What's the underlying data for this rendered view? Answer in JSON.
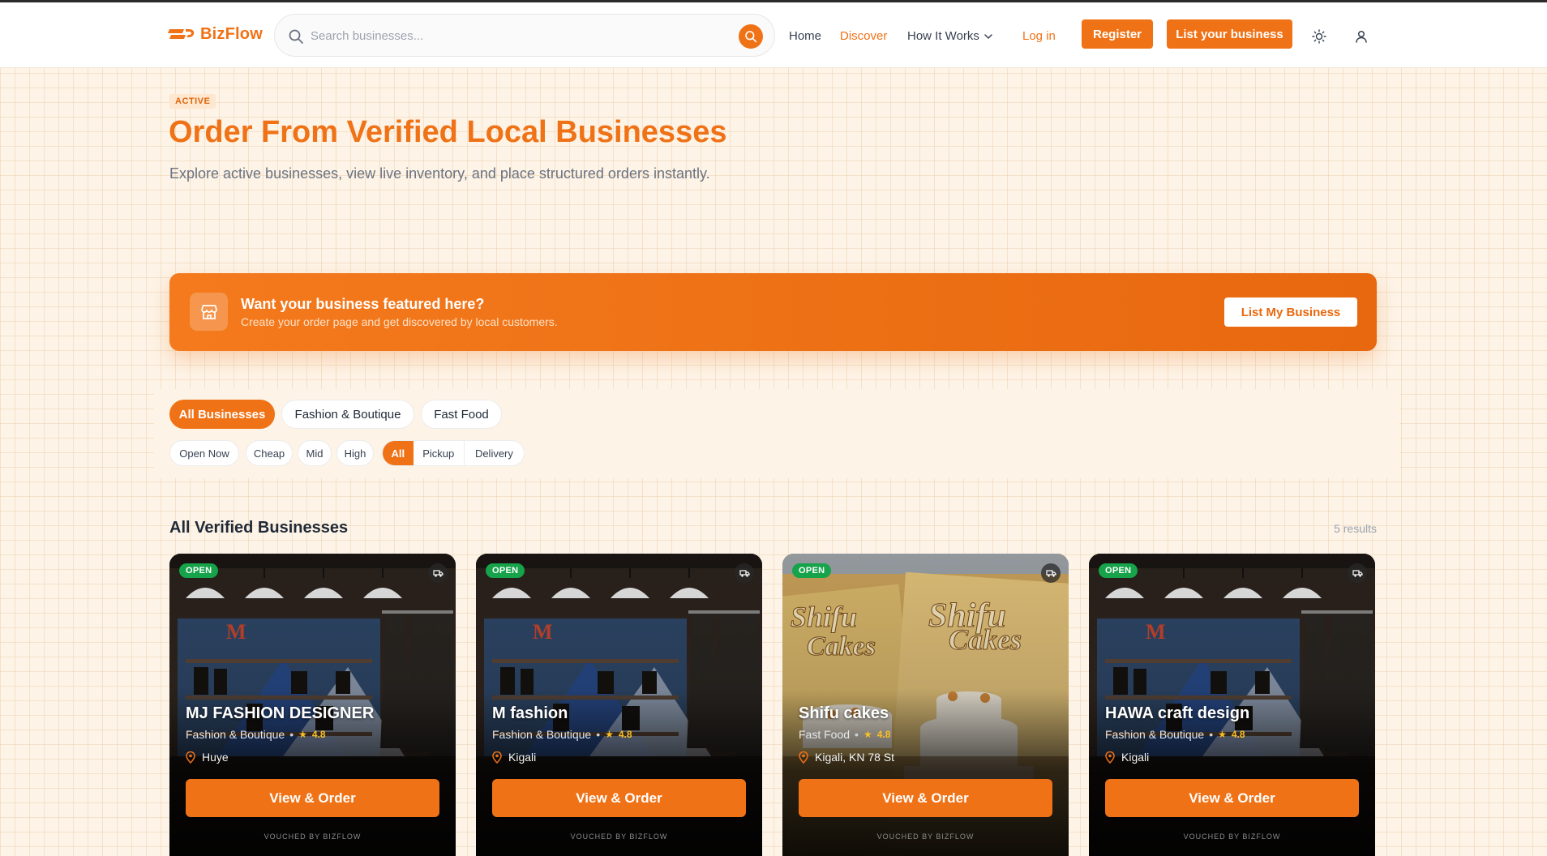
{
  "nav": {
    "brand": "BizFlow",
    "search_placeholder": "Search businesses...",
    "home": "Home",
    "discover": "Discover",
    "how_it_works": "How It Works",
    "login": "Log in",
    "register": "Register",
    "list_business": "List your business",
    "accent_color": "#f07216"
  },
  "hero": {
    "badge": "ACTIVE",
    "title": "Order From Verified Local Businesses",
    "subtitle": "Explore active businesses, view live inventory, and place structured orders instantly."
  },
  "promo": {
    "title": "Want your business featured here?",
    "subtitle": "Create your order page and get discovered by local customers.",
    "button": "List My Business",
    "icon": "store-icon"
  },
  "filters": {
    "categories": [
      "All Businesses",
      "Fashion & Boutique",
      "Fast Food"
    ],
    "active_category": "All Businesses",
    "status": "Open Now",
    "prices": [
      "Cheap",
      "Mid",
      "High"
    ],
    "fulfillment": [
      "All",
      "Pickup",
      "Delivery"
    ],
    "active_fulfillment": "All"
  },
  "results": {
    "title": "All Verified Businesses",
    "count": "5 results"
  },
  "cards": [
    {
      "status": "OPEN",
      "name": "MJ FASHION DESIGNER",
      "category": "Fashion & Boutique",
      "rating": "4.8",
      "location": "Huye",
      "button": "View & Order",
      "footer": "VOUCHED BY BIZFLOW",
      "image": "boutique"
    },
    {
      "status": "OPEN",
      "name": "M fashion",
      "category": "Fashion & Boutique",
      "rating": "4.8",
      "location": "Kigali",
      "button": "View & Order",
      "footer": "VOUCHED BY BIZFLOW",
      "image": "boutique"
    },
    {
      "status": "OPEN",
      "name": "Shifu cakes",
      "category": "Fast Food",
      "rating": "4.8",
      "location": "Kigali, KN 78 St",
      "button": "View & Order",
      "footer": "VOUCHED BY BIZFLOW",
      "image": "cakes"
    },
    {
      "status": "OPEN",
      "name": "HAWA craft design",
      "category": "Fashion & Boutique",
      "rating": "4.8",
      "location": "Kigali",
      "button": "View & Order",
      "footer": "VOUCHED BY BIZFLOW",
      "image": "boutique"
    }
  ]
}
